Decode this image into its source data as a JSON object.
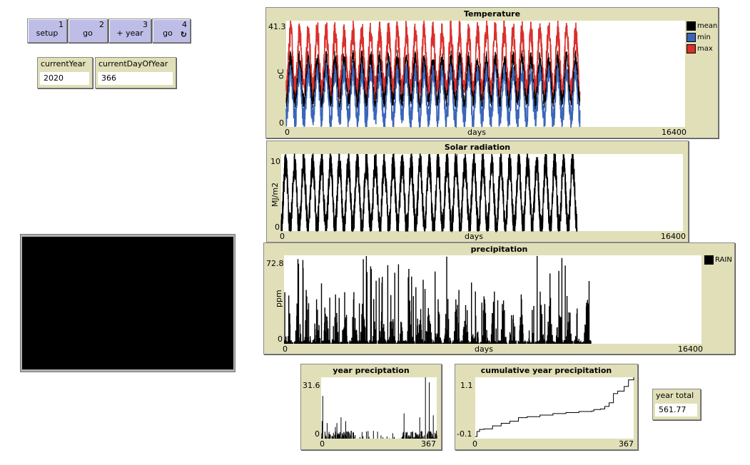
{
  "buttons": [
    {
      "label": "setup",
      "key": "1",
      "forever": false
    },
    {
      "label": "go",
      "key": "2",
      "forever": false
    },
    {
      "label": "+ year",
      "key": "3",
      "forever": false
    },
    {
      "label": "go",
      "key": "4",
      "forever": true,
      "forever_icon": "↻"
    }
  ],
  "monitors": {
    "currentYear": {
      "label": "currentYear",
      "value": "2020"
    },
    "currentDayOfYear": {
      "label": "currentDayOfYear",
      "value": "366"
    },
    "yearTotal": {
      "label": "year total",
      "value": "561.77"
    }
  },
  "colors": {
    "panel": "#e0dfb8",
    "button": "#bebde8",
    "mean": "#000000",
    "min": "#3a66b8",
    "max": "#d9302c",
    "rain": "#000000"
  },
  "chart_data": [
    {
      "id": "temperature",
      "type": "line",
      "title": "Temperature",
      "xlabel": "days",
      "ylabel": "oC",
      "xlim": [
        0,
        16400
      ],
      "ylim": [
        0,
        41.3
      ],
      "x_tick_labels": [
        "0",
        "16400"
      ],
      "y_tick_labels": [
        "0",
        "41.3"
      ],
      "legend_position": "right",
      "data_extent_days": 12080,
      "cycle_length_days": 366,
      "series": [
        {
          "name": "mean",
          "color": "#000000",
          "seasonal_low": 10,
          "seasonal_high": 27
        },
        {
          "name": "min",
          "color": "#3a66b8",
          "seasonal_low": 3,
          "seasonal_high": 22
        },
        {
          "name": "max",
          "color": "#d9302c",
          "seasonal_low": 14,
          "seasonal_high": 37
        }
      ]
    },
    {
      "id": "solar",
      "type": "line",
      "title": "Solar radiation",
      "xlabel": "days",
      "ylabel": "MJ/m2",
      "xlim": [
        0,
        16400
      ],
      "ylim": [
        0,
        10
      ],
      "x_tick_labels": [
        "0",
        "16400"
      ],
      "y_tick_labels": [
        "0",
        "10"
      ],
      "data_extent_days": 12080,
      "cycle_length_days": 366,
      "series": [
        {
          "name": "solar",
          "color": "#000000",
          "seasonal_low": 0.3,
          "seasonal_high": 8.9
        }
      ]
    },
    {
      "id": "precipitation",
      "type": "bar",
      "title": "precipitation",
      "xlabel": "days",
      "ylabel": "ppm",
      "xlim": [
        0,
        16400
      ],
      "ylim": [
        0,
        72.8
      ],
      "x_tick_labels": [
        "0",
        "16400"
      ],
      "y_tick_labels": [
        "0",
        "72.8"
      ],
      "legend_position": "right",
      "data_extent_days": 12080,
      "cycle_length_days": 366,
      "series": [
        {
          "name": "RAIN",
          "color": "#000000",
          "max_value": 72.8
        }
      ]
    },
    {
      "id": "year-precipitation",
      "type": "bar",
      "title": "year preciptation",
      "xlabel": "",
      "ylabel": "",
      "xlim": [
        0,
        367
      ],
      "ylim": [
        0,
        31.6
      ],
      "x_tick_labels": [
        "0",
        "367"
      ],
      "y_tick_labels": [
        "0",
        "31.6"
      ],
      "peaks": [
        {
          "day": 4,
          "value": 22
        },
        {
          "day": 2,
          "value": 9
        },
        {
          "day": 18,
          "value": 8
        },
        {
          "day": 44,
          "value": 6
        },
        {
          "day": 49,
          "value": 8
        },
        {
          "day": 62,
          "value": 11
        },
        {
          "day": 77,
          "value": 9
        },
        {
          "day": 95,
          "value": 4
        },
        {
          "day": 165,
          "value": 4
        },
        {
          "day": 262,
          "value": 13
        },
        {
          "day": 312,
          "value": 11
        },
        {
          "day": 330,
          "value": 31.6
        },
        {
          "day": 342,
          "value": 29
        },
        {
          "day": 355,
          "value": 12
        },
        {
          "day": 365,
          "value": 4
        }
      ]
    },
    {
      "id": "cumulative-year-precipitation",
      "type": "line",
      "title": "cumulative year precipitation",
      "xlabel": "",
      "ylabel": "",
      "xlim": [
        0,
        367
      ],
      "ylim": [
        -0.1,
        1.1
      ],
      "x_tick_labels": [
        "0",
        "367"
      ],
      "y_tick_labels": [
        "-0.1",
        "1.1"
      ],
      "x": [
        0,
        4,
        10,
        20,
        40,
        60,
        80,
        100,
        120,
        150,
        180,
        210,
        240,
        270,
        275,
        290,
        300,
        310,
        320,
        330,
        345,
        355,
        367
      ],
      "y": [
        -0.06,
        0.04,
        0.08,
        0.09,
        0.15,
        0.2,
        0.24,
        0.31,
        0.33,
        0.36,
        0.39,
        0.41,
        0.43,
        0.44,
        0.47,
        0.48,
        0.53,
        0.6,
        0.78,
        0.83,
        0.92,
        1.05,
        1.1
      ]
    }
  ]
}
